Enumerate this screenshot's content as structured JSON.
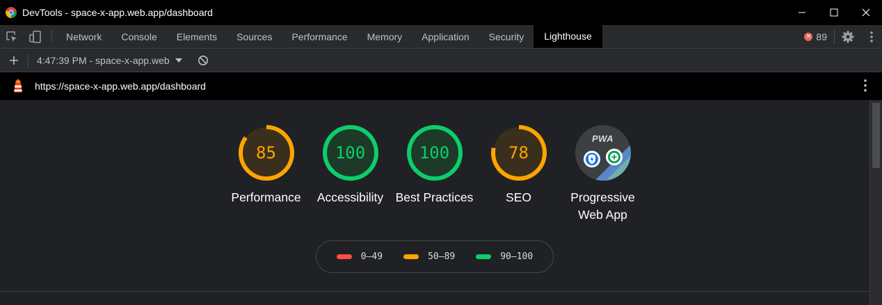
{
  "window": {
    "title": "DevTools - space-x-app.web.app/dashboard",
    "app_icon": "chrome-icon"
  },
  "tabs": [
    {
      "label": "Network"
    },
    {
      "label": "Console"
    },
    {
      "label": "Elements"
    },
    {
      "label": "Sources"
    },
    {
      "label": "Performance"
    },
    {
      "label": "Memory"
    },
    {
      "label": "Application"
    },
    {
      "label": "Security"
    },
    {
      "label": "Lighthouse",
      "active": true
    }
  ],
  "errors": {
    "count": "89",
    "icon": "error-icon",
    "color": "#e46962"
  },
  "toolbar": {
    "report_select": "4:47:39 PM - space-x-app.web",
    "icons": [
      "plus-icon",
      "caret-down-icon",
      "clear-icon"
    ]
  },
  "url_bar": {
    "url": "https://space-x-app.web.app/dashboard",
    "icon": "lighthouse-icon"
  },
  "gauges": [
    {
      "label": "Performance",
      "score": "85",
      "value": 0.85,
      "color": "#ffa400",
      "bg": "#3a2f1c"
    },
    {
      "label": "Accessibility",
      "score": "100",
      "value": 1.0,
      "color": "#0cce6b",
      "bg": "#1d3a28"
    },
    {
      "label": "Best Practices",
      "score": "100",
      "value": 1.0,
      "color": "#0cce6b",
      "bg": "#1d3a28"
    },
    {
      "label": "SEO",
      "score": "78",
      "value": 0.78,
      "color": "#ffa400",
      "bg": "#3a2f1c"
    }
  ],
  "pwa": {
    "label": "Progressive Web App",
    "badge_text": "PWA",
    "icons": [
      "fast-reliable-icon",
      "installable-icon"
    ]
  },
  "legend": [
    {
      "range": "0–49",
      "color": "#ff4e42"
    },
    {
      "range": "50–89",
      "color": "#ffa400"
    },
    {
      "range": "90–100",
      "color": "#0cce6b"
    }
  ],
  "colors": {
    "background": "#202124",
    "pass": "#0cce6b",
    "average": "#ffa400",
    "fail": "#ff4e42"
  }
}
